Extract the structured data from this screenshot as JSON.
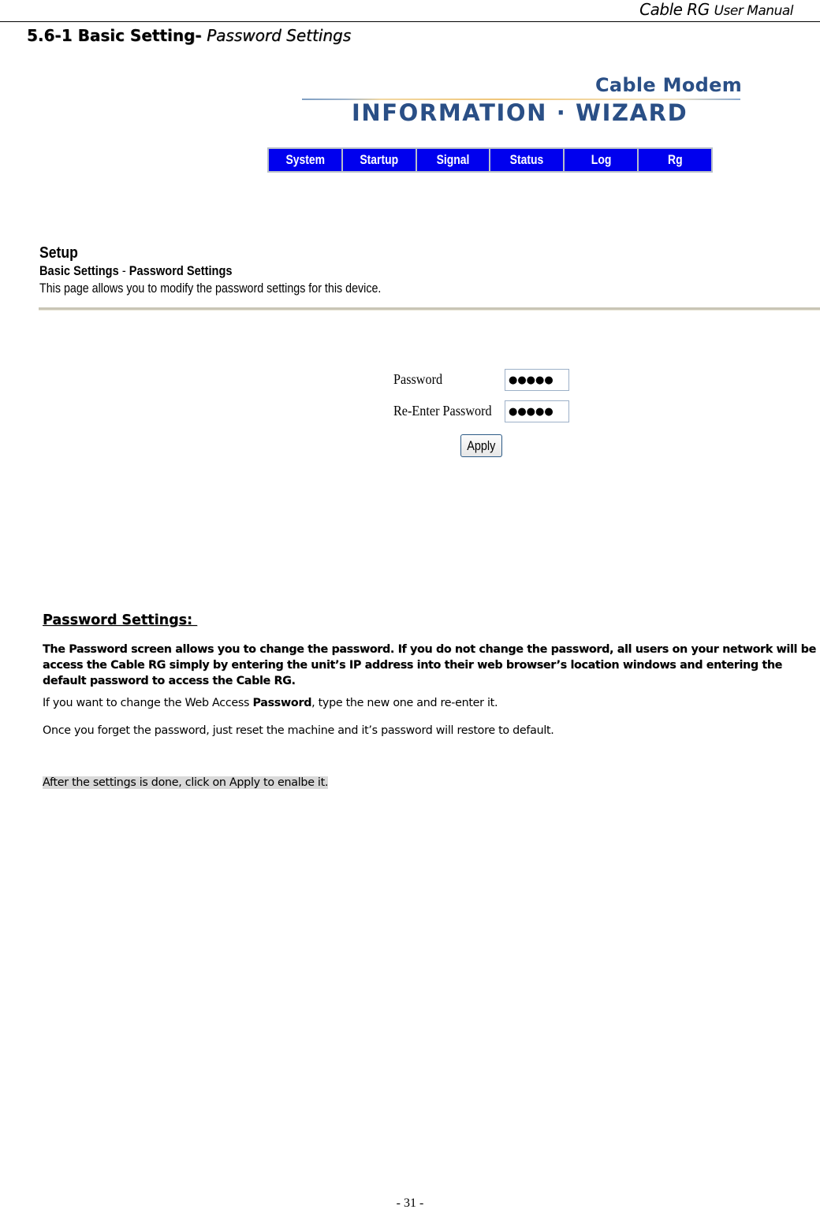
{
  "running_header": {
    "title_large": "Cable RG",
    "title_small": "User Manual"
  },
  "section": {
    "number_bold": "5.6-1 Basic Setting-",
    "title_italic": "Password Settings"
  },
  "logo": {
    "top_text": "Cable Modem",
    "main_text": "INFORMATION · WIZARD",
    "color": "#2a4f86"
  },
  "nav": {
    "items": [
      {
        "label": "System"
      },
      {
        "label": "Startup"
      },
      {
        "label": "Signal"
      },
      {
        "label": "Status"
      },
      {
        "label": "Log"
      },
      {
        "label": "Rg"
      }
    ],
    "background_color": "#0000ee"
  },
  "setup": {
    "title": "Setup",
    "subtitle_part1": "Basic Settings",
    "subtitle_sep": " - ",
    "subtitle_part2": "Password Settings",
    "description": "This page allows you to modify the password settings for this device."
  },
  "form": {
    "password_label": "Password",
    "password_value": "●●●●●",
    "reenter_label": "Re-Enter Password",
    "reenter_value": "●●●●●",
    "apply_label": "Apply"
  },
  "doc": {
    "heading": "Password Settings: ",
    "bold_paragraph": "The Password screen allows you to change the password. If you do not change the password, all users on your network will be access the Cable RG simply by entering the unit’s IP address into their web browser’s location windows and entering the default password to access the Cable RG.",
    "para1_before": "If you want to change the Web Access ",
    "para1_bold": "Password",
    "para1_after": ", type the new one and re-enter it.",
    "para2": "Once you forget the password, just reset the machine and it’s password will restore to default.",
    "para3": "After the settings is done, click on Apply to enalbe it."
  },
  "page_number": "- 31 -"
}
